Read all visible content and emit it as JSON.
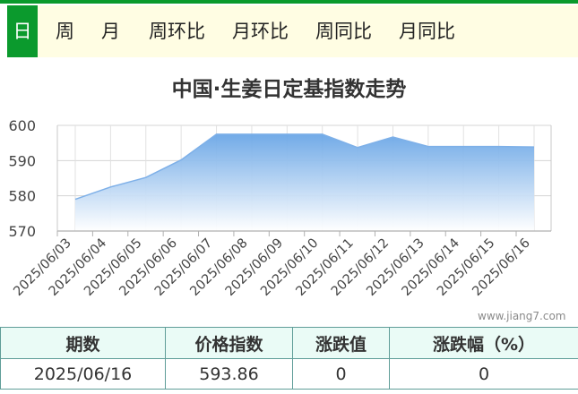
{
  "tabs": [
    {
      "label": "日",
      "active": true
    },
    {
      "label": "周",
      "active": false
    },
    {
      "label": "月",
      "active": false
    },
    {
      "label": "周环比",
      "active": false
    },
    {
      "label": "月环比",
      "active": false
    },
    {
      "label": "周同比",
      "active": false
    },
    {
      "label": "月同比",
      "active": false
    }
  ],
  "chart_data": {
    "type": "area",
    "title": "中国·生姜日定基指数走势",
    "x": [
      "2025/06/03",
      "2025/06/04",
      "2025/06/05",
      "2025/06/06",
      "2025/06/07",
      "2025/06/08",
      "2025/06/09",
      "2025/06/10",
      "2025/06/11",
      "2025/06/12",
      "2025/06/13",
      "2025/06/14",
      "2025/06/15",
      "2025/06/16"
    ],
    "series": [
      {
        "values": [
          579.0,
          582.5,
          585.2,
          590.2,
          597.5,
          597.5,
          597.5,
          597.5,
          593.7,
          596.7,
          594.0,
          594.0,
          594.0,
          593.86
        ]
      }
    ],
    "yticks": [
      570,
      580,
      590,
      600
    ],
    "ylim": [
      570,
      600
    ],
    "grid": true,
    "colors": {
      "fill_top": "#6aa6e6",
      "fill_bottom": "#ffffff",
      "line": "#7eb0e8"
    }
  },
  "watermark": "www.jiang7.com",
  "summary": {
    "headers": [
      "期数",
      "价格指数",
      "涨跌值",
      "涨跌幅（%）"
    ],
    "row": [
      "2025/06/16",
      "593.86",
      "0",
      "0"
    ]
  }
}
